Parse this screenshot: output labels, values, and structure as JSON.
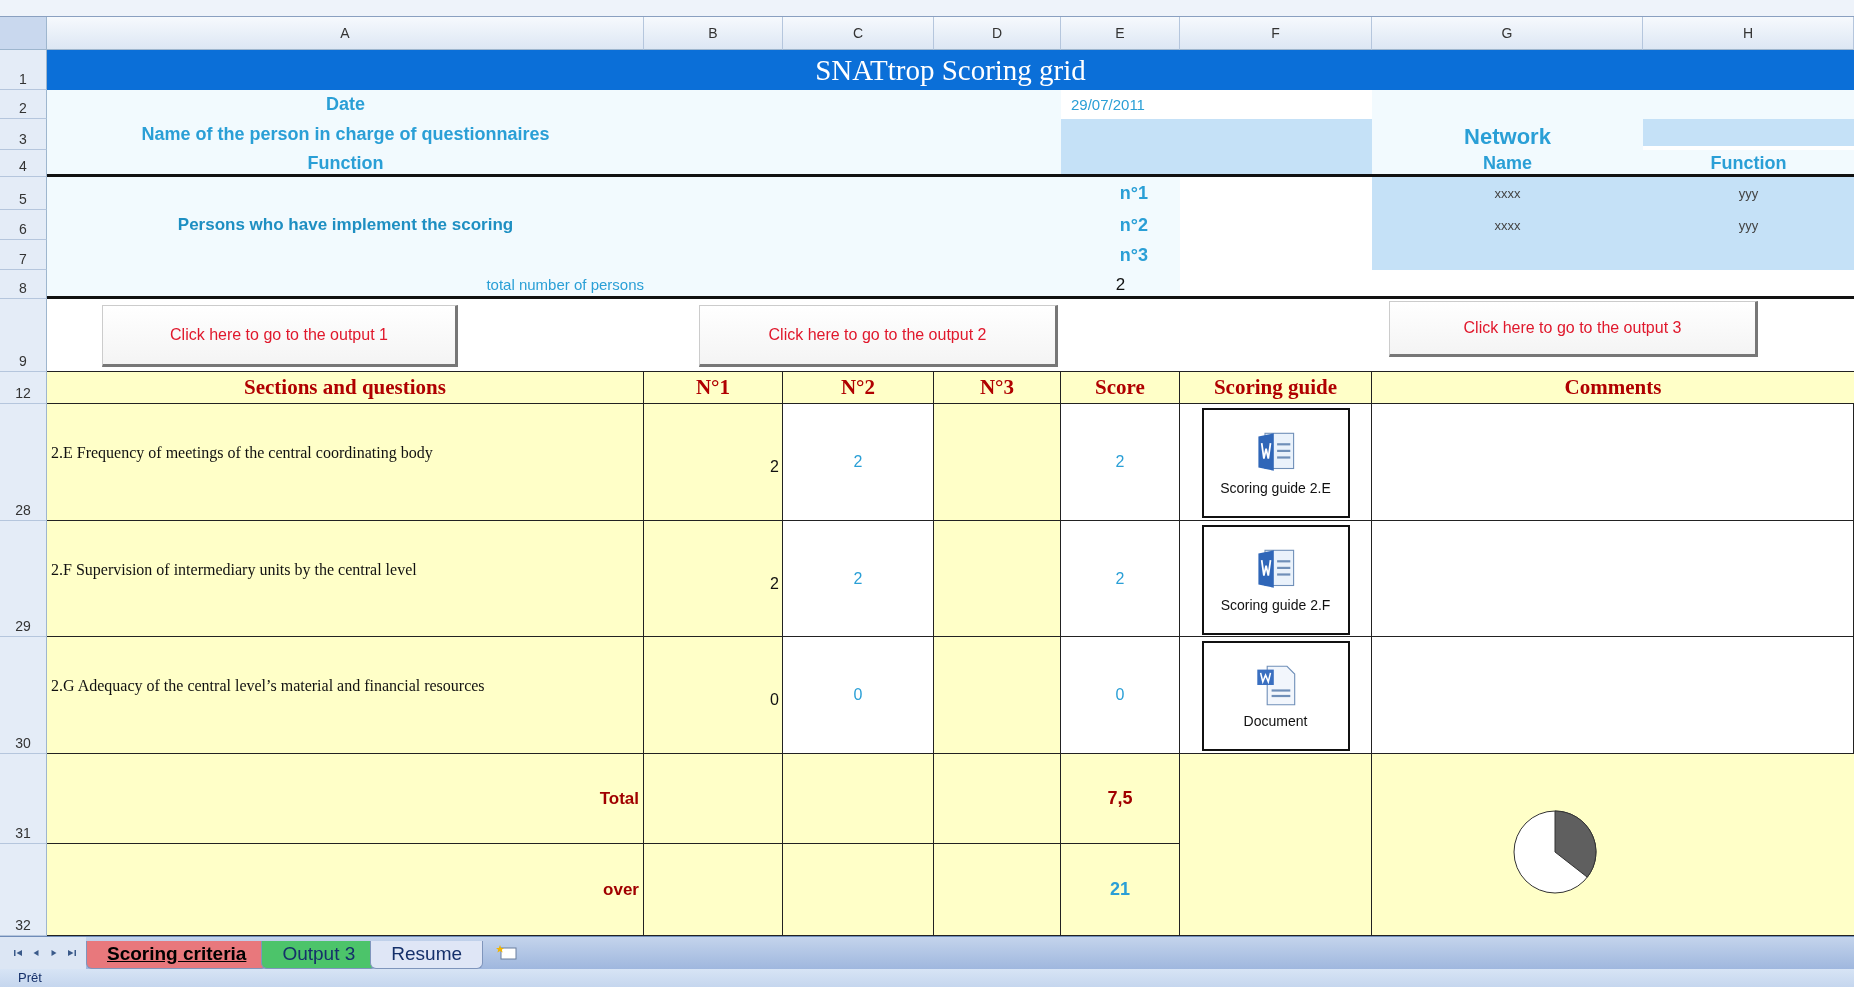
{
  "columns": [
    "A",
    "B",
    "C",
    "D",
    "E",
    "F",
    "G",
    "H"
  ],
  "row_numbers": [
    "1",
    "2",
    "3",
    "4",
    "5",
    "6",
    "7",
    "8",
    "9",
    "12",
    "28",
    "29",
    "30",
    "31",
    "32"
  ],
  "title": "SNATtrop Scoring grid",
  "info": {
    "date_label": "Date",
    "person_label": "Name of the person in charge of questionnaires",
    "function_label": "Function",
    "date_value": "29/07/2011"
  },
  "network": {
    "title": "Network",
    "name_label": "Name",
    "function_label": "Function",
    "members": [
      {
        "name": "xxxx",
        "function": "yyy"
      },
      {
        "name": "xxxx",
        "function": "yyy"
      }
    ]
  },
  "persons": {
    "label": "Persons who have implement the scoring",
    "numbers": [
      "n°1",
      "n°2",
      "n°3"
    ],
    "total_label": "total number of persons",
    "total": "2"
  },
  "output_buttons": [
    "Click here to go to the output 1",
    "Click here to go to the output 2",
    "Click here to go to the output 3"
  ],
  "table": {
    "columns": [
      "Sections and questions",
      "N°1",
      "N°2",
      "N°3",
      "Score",
      "Scoring guide",
      "Comments"
    ],
    "rows": [
      {
        "question": "2.E Frequency of meetings of the central coordinating body",
        "n1": "2",
        "n2": "2",
        "score": "2",
        "guide": {
          "kind": "word",
          "label": "Scoring guide 2.E"
        }
      },
      {
        "question": "2.F Supervision of intermediary units by the central level",
        "n1": "2",
        "n2": "2",
        "score": "2",
        "guide": {
          "kind": "word",
          "label": "Scoring guide 2.F"
        }
      },
      {
        "question": "2.G Adequacy of the central level’s material and financial resources",
        "n1": "0",
        "n2": "0",
        "score": "0",
        "guide": {
          "kind": "document",
          "label": "Document"
        }
      }
    ],
    "total": {
      "label": "Total",
      "score": "7,5"
    },
    "over": {
      "label": "over",
      "score": "21"
    }
  },
  "sheet_tabs": [
    {
      "label": "Scoring criteria",
      "selected": true,
      "color": "#e8787c"
    },
    {
      "label": "Output 3",
      "selected": false,
      "color": "#4cc46a"
    },
    {
      "label": "Resume",
      "selected": false
    }
  ],
  "status_bar": "Prêt"
}
